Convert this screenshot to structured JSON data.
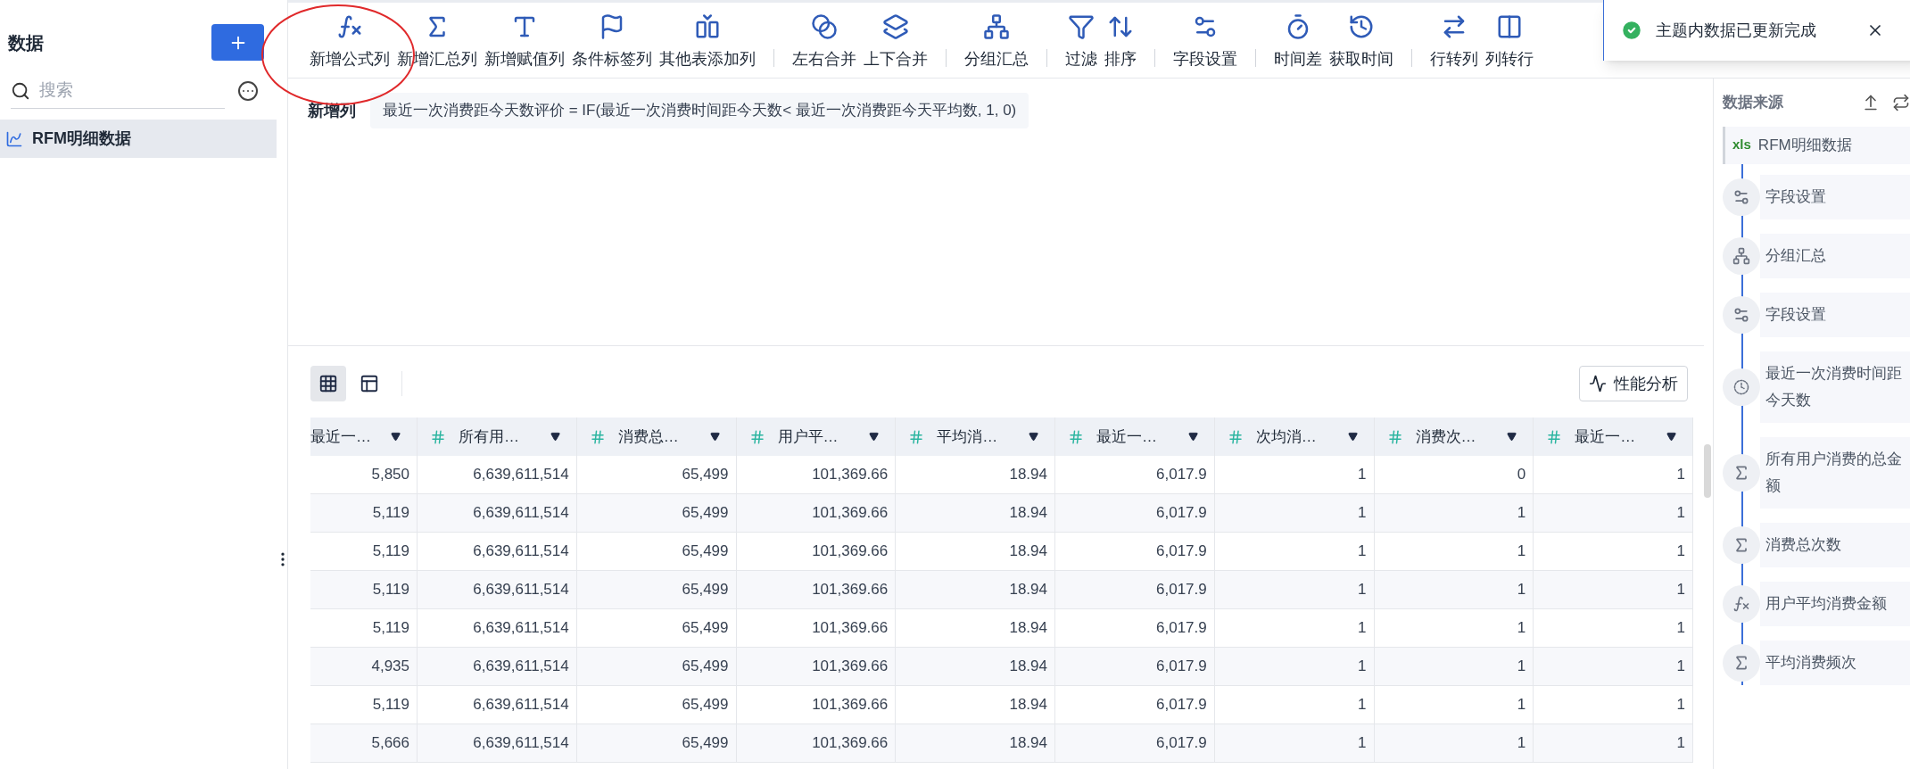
{
  "sidebar": {
    "title": "数据",
    "search": {
      "placeholder": "搜索"
    },
    "items": [
      {
        "label": "RFM明细数据",
        "selected": true
      }
    ]
  },
  "toolbar": {
    "groups": [
      {
        "items": [
          {
            "label": "新增公式列",
            "kind": "formula"
          },
          {
            "label": "新增汇总列",
            "kind": "sum"
          },
          {
            "label": "新增赋值列",
            "kind": "assign"
          },
          {
            "label": "条件标签列",
            "kind": "tag"
          },
          {
            "label": "其他表添加列",
            "kind": "addtable"
          }
        ]
      },
      {
        "items": [
          {
            "label": "左右合并",
            "kind": "joinlr"
          },
          {
            "label": "上下合并",
            "kind": "jointb"
          }
        ]
      },
      {
        "items": [
          {
            "label": "分组汇总",
            "kind": "group"
          }
        ]
      },
      {
        "items": [
          {
            "label": "过滤",
            "kind": "filter"
          },
          {
            "label": "排序",
            "kind": "sort"
          }
        ]
      },
      {
        "items": [
          {
            "label": "字段设置",
            "kind": "field"
          }
        ]
      },
      {
        "items": [
          {
            "label": "时间差",
            "kind": "timediff"
          },
          {
            "label": "获取时间",
            "kind": "time"
          }
        ]
      },
      {
        "items": [
          {
            "label": "行转列",
            "kind": "rowcol"
          },
          {
            "label": "列转行",
            "kind": "colrow"
          }
        ]
      }
    ]
  },
  "formula_bar": {
    "label": "新增列",
    "formula": "最近一次消费距今天数评价 = IF(最近一次消费时间距今天数< 最近一次消费距今天平均数, 1, 0)"
  },
  "table_toolbar": {
    "views": [
      {
        "kind": "grid",
        "selected": true
      },
      {
        "kind": "layout",
        "selected": false
      }
    ],
    "analysis_button": "性能分析"
  },
  "table": {
    "columns": [
      {
        "label": "最近一…",
        "kind": "partial"
      },
      {
        "label": "所有用…",
        "kind": "number"
      },
      {
        "label": "消费总…",
        "kind": "number"
      },
      {
        "label": "用户平…",
        "kind": "number"
      },
      {
        "label": "平均消…",
        "kind": "number"
      },
      {
        "label": "最近一…",
        "kind": "number"
      },
      {
        "label": "次均消…",
        "kind": "number"
      },
      {
        "label": "消费次…",
        "kind": "number"
      },
      {
        "label": "最近一…",
        "kind": "number"
      }
    ],
    "rows": [
      [
        "5,850",
        "6,639,611,514",
        "65,499",
        "101,369.66",
        "18.94",
        "6,017.9",
        "1",
        "0",
        "1"
      ],
      [
        "5,119",
        "6,639,611,514",
        "65,499",
        "101,369.66",
        "18.94",
        "6,017.9",
        "1",
        "1",
        "1"
      ],
      [
        "5,119",
        "6,639,611,514",
        "65,499",
        "101,369.66",
        "18.94",
        "6,017.9",
        "1",
        "1",
        "1"
      ],
      [
        "5,119",
        "6,639,611,514",
        "65,499",
        "101,369.66",
        "18.94",
        "6,017.9",
        "1",
        "1",
        "1"
      ],
      [
        "5,119",
        "6,639,611,514",
        "65,499",
        "101,369.66",
        "18.94",
        "6,017.9",
        "1",
        "1",
        "1"
      ],
      [
        "4,935",
        "6,639,611,514",
        "65,499",
        "101,369.66",
        "18.94",
        "6,017.9",
        "1",
        "1",
        "1"
      ],
      [
        "5,119",
        "6,639,611,514",
        "65,499",
        "101,369.66",
        "18.94",
        "6,017.9",
        "1",
        "1",
        "1"
      ],
      [
        "5,666",
        "6,639,611,514",
        "65,499",
        "101,369.66",
        "18.94",
        "6,017.9",
        "1",
        "1",
        "1"
      ]
    ]
  },
  "source_panel": {
    "title": "数据来源",
    "source": {
      "badge": "xls",
      "label": "RFM明细数据"
    },
    "steps": [
      {
        "label": "字段设置",
        "kind": "field"
      },
      {
        "label": "分组汇总",
        "kind": "group"
      },
      {
        "label": "字段设置",
        "kind": "field"
      },
      {
        "label": "最近一次消费时间距今天数",
        "kind": "timediff"
      },
      {
        "label": "所有用户消费的总金额",
        "kind": "sum"
      },
      {
        "label": "消费总次数",
        "kind": "sum"
      },
      {
        "label": "用户平均消费金额",
        "kind": "formula"
      },
      {
        "label": "平均消费频次",
        "kind": "sum"
      }
    ]
  },
  "toast": {
    "message": "主题内数据已更新完成"
  }
}
